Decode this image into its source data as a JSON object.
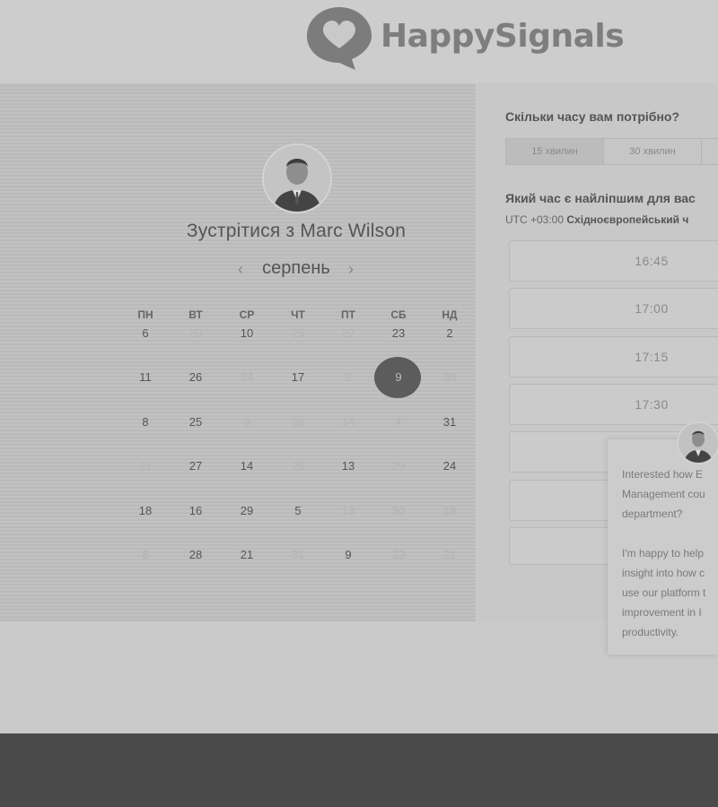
{
  "header": {
    "brand": "HappySignals"
  },
  "calendar": {
    "title": "Зустрітися з Marc Wilson",
    "month": "серпень",
    "prev_icon": "chevron-left-icon",
    "next_icon": "chevron-right-icon",
    "weekdays": [
      "ПН",
      "ВТ",
      "СР",
      "ЧТ",
      "ПТ",
      "СБ",
      "НД"
    ],
    "weeks": [
      [
        {
          "d": "6",
          "dim": false
        },
        {
          "d": "20",
          "dim": true
        },
        {
          "d": "10",
          "dim": false
        },
        {
          "d": "29",
          "dim": true
        },
        {
          "d": "22",
          "dim": true
        },
        {
          "d": "23",
          "dim": false
        },
        {
          "d": "2",
          "dim": false
        }
      ],
      [
        {
          "d": "11",
          "dim": false
        },
        {
          "d": "26",
          "dim": false
        },
        {
          "d": "24",
          "dim": true
        },
        {
          "d": "17",
          "dim": false
        },
        {
          "d": "2",
          "dim": true
        },
        {
          "d": "9",
          "dim": false,
          "selected": true
        },
        {
          "d": "30",
          "dim": true
        }
      ],
      [
        {
          "d": "8",
          "dim": false
        },
        {
          "d": "25",
          "dim": false
        },
        {
          "d": "9",
          "dim": true
        },
        {
          "d": "26",
          "dim": true
        },
        {
          "d": "14",
          "dim": true
        },
        {
          "d": "4",
          "dim": true
        },
        {
          "d": "31",
          "dim": false
        }
      ],
      [
        {
          "d": "31",
          "dim": true
        },
        {
          "d": "27",
          "dim": false
        },
        {
          "d": "14",
          "dim": false
        },
        {
          "d": "26",
          "dim": true
        },
        {
          "d": "13",
          "dim": false
        },
        {
          "d": "29",
          "dim": true
        },
        {
          "d": "24",
          "dim": false
        }
      ],
      [
        {
          "d": "18",
          "dim": false
        },
        {
          "d": "16",
          "dim": false
        },
        {
          "d": "29",
          "dim": false
        },
        {
          "d": "5",
          "dim": false
        },
        {
          "d": "13",
          "dim": true
        },
        {
          "d": "30",
          "dim": true
        },
        {
          "d": "19",
          "dim": true
        }
      ],
      [
        {
          "d": "6",
          "dim": true
        },
        {
          "d": "28",
          "dim": false
        },
        {
          "d": "21",
          "dim": false
        },
        {
          "d": "31",
          "dim": true
        },
        {
          "d": "9",
          "dim": false
        },
        {
          "d": "22",
          "dim": true
        },
        {
          "d": "21",
          "dim": true
        }
      ]
    ]
  },
  "duration": {
    "question": "Скільки часу вам потрібно?",
    "options": [
      "15 хвилин",
      "30 хвилин",
      ""
    ],
    "active_index": 0
  },
  "times": {
    "question": "Який час є найліпшим для вас",
    "tz_offset": "UTC +03:00",
    "tz_name": "Східноєвропейський ч",
    "slots": [
      "16:45",
      "17:00",
      "17:15",
      "17:30",
      "",
      "",
      ""
    ]
  },
  "popup": {
    "lines_a": [
      "Interested how E",
      "Management cou",
      "department?"
    ],
    "lines_b": [
      "I'm happy to help",
      "insight into how c",
      "use our platform t",
      "improvement in I",
      "productivity."
    ]
  }
}
